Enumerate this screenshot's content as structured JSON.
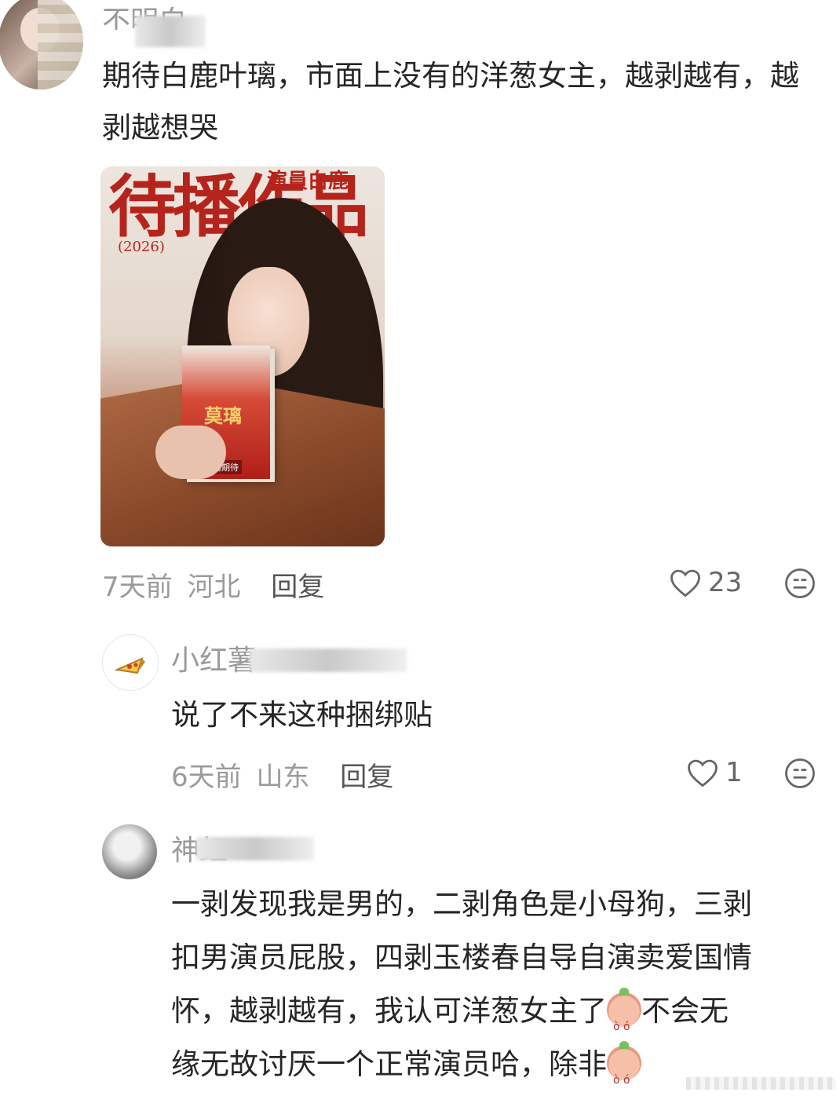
{
  "comments": [
    {
      "username": "不明白",
      "text": "期待白鹿叶璃，市面上没有的洋葱女主，越剥越有，越剥越想哭",
      "time": "7天前",
      "location": "河北",
      "reply_label": "回复",
      "likes": "23",
      "image": {
        "headline": "待播作品",
        "subheadline": "演員白鹿",
        "year": "(2026)",
        "book_title": "莫璃",
        "book_caption": "敬请期待"
      }
    },
    {
      "username": "小红薯",
      "text": "说了不来这种捆绑贴",
      "time": "6天前",
      "location": "山东",
      "reply_label": "回复",
      "likes": "1"
    },
    {
      "username": "神红",
      "text_lines": [
        "一剥发现我是男的，二剥角色是小母狗，三剥",
        "扣男演员屁股，四剥玉楼春自导自演卖爱国情",
        "怀，越剥越有，我认可洋葱女主了",
        "缘无故讨厌一个正常演员哈，除非"
      ],
      "inline_after_line3": "不会无"
    }
  ],
  "colors": {
    "text": "#262626",
    "meta": "#9a9a9a",
    "magazine_red": "#b5241c",
    "coat_brown": "#8a4a2a"
  },
  "icons": [
    "heart-icon",
    "emoji-reaction-icon",
    "pizza-avatar-icon",
    "onion-emoji-icon"
  ]
}
